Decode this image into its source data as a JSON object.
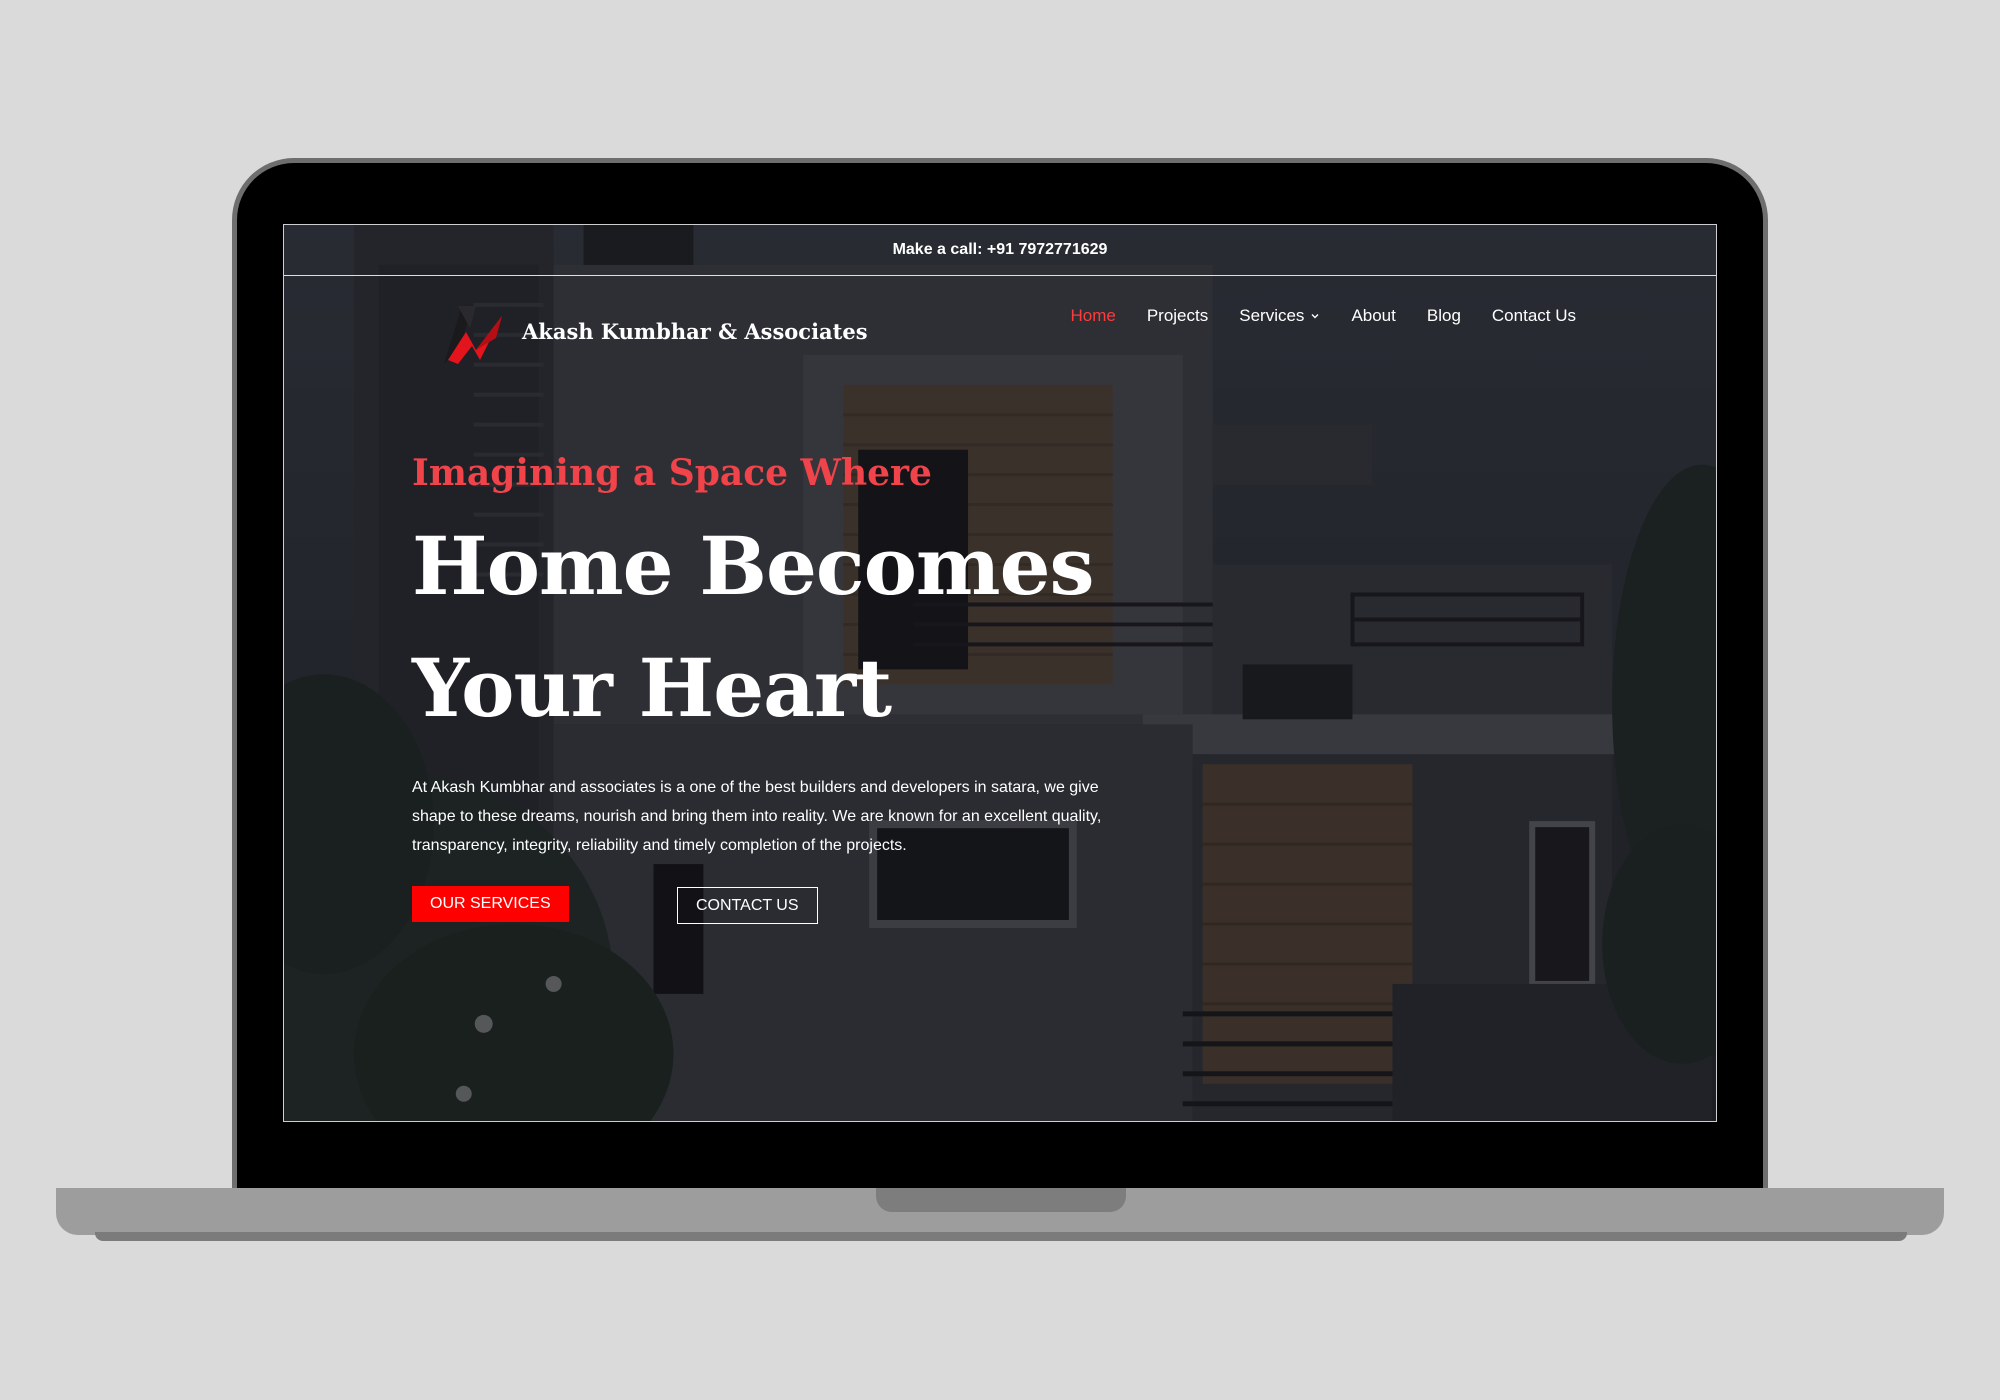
{
  "topbar": {
    "call_text": "Make a call: +91 7972771629"
  },
  "brand": {
    "name": "Akash Kumbhar & Associates",
    "logo_icon": "ak-logo-icon"
  },
  "nav": {
    "items": [
      {
        "label": "Home",
        "active": true
      },
      {
        "label": "Projects",
        "active": false
      },
      {
        "label": "Services",
        "active": false,
        "has_dropdown": true
      },
      {
        "label": "About",
        "active": false
      },
      {
        "label": "Blog",
        "active": false
      },
      {
        "label": "Contact Us",
        "active": false
      }
    ]
  },
  "hero": {
    "subtitle": "Imagining a Space Where",
    "headline_line1": "Home Becomes",
    "headline_line2": "Your Heart",
    "description": "At Akash Kumbhar and associates is a one of the best  builders and developers in satara, we give shape to these dreams, nourish and bring them into reality. We are known for an excellent quality, transparency, integrity, reliability and timely completion of the projects.",
    "primary_button": "OUR SERVICES",
    "secondary_button": "CONTACT US"
  },
  "colors": {
    "accent_red": "#ff0000",
    "subtitle_red": "#f1434a",
    "nav_active": "#ff3c3c"
  }
}
